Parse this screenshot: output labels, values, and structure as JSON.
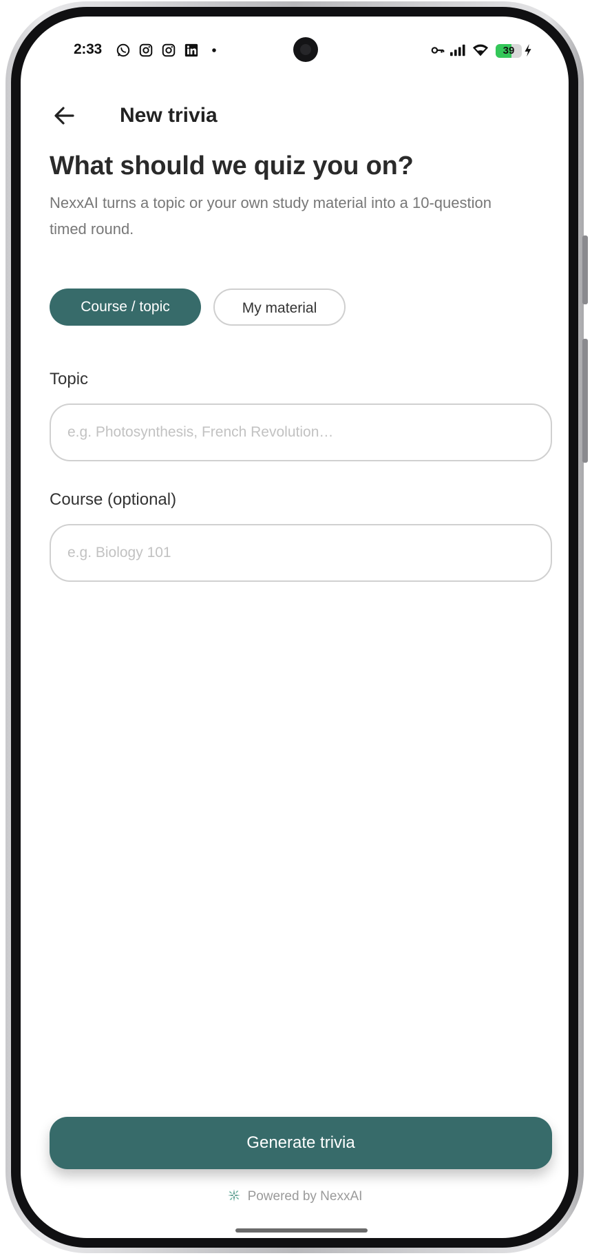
{
  "status_bar": {
    "time": "2:33",
    "battery_level": "39",
    "notification_icons": [
      "whatsapp-icon",
      "instagram-icon",
      "instagram-icon",
      "linkedin-icon",
      "dot-icon"
    ],
    "system_icons": [
      "vpn-key-icon",
      "signal-icon",
      "wifi-icon",
      "battery-icon",
      "charging-bolt-icon"
    ]
  },
  "header": {
    "title": "New trivia",
    "back_icon": "arrow-left-icon"
  },
  "main": {
    "headline": "What should we quiz you on?",
    "subtitle": "NexxAI turns a topic or your own study material into a 10-question timed round.",
    "tabs": [
      {
        "label": "Course / topic",
        "selected": true
      },
      {
        "label": "My material",
        "selected": false
      }
    ],
    "topic_field": {
      "label": "Topic",
      "value": "",
      "placeholder": "e.g. Photosynthesis, French Revolution…"
    },
    "course_field": {
      "label": "Course (optional)",
      "value": "",
      "placeholder": "e.g. Biology 101"
    }
  },
  "footer": {
    "generate_label": "Generate trivia",
    "powered_by": "Powered by NexxAI",
    "powered_icon": "sparkle-icon"
  },
  "colors": {
    "accent": "#376b6a",
    "battery_green": "#34c759"
  }
}
